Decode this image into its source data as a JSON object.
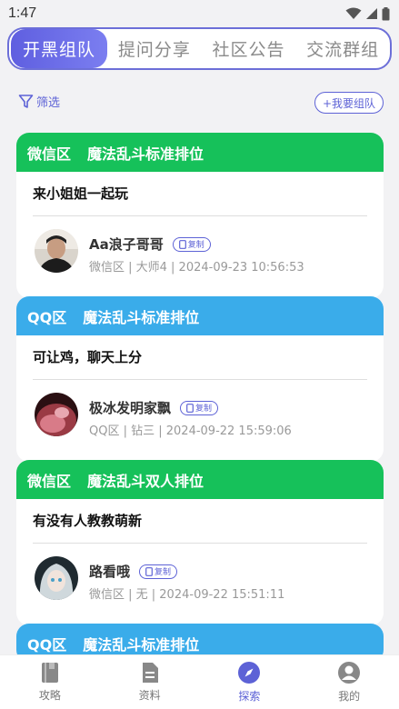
{
  "status": {
    "time": "1:47"
  },
  "tabs": [
    {
      "label": "开黑组队",
      "active": true
    },
    {
      "label": "提问分享",
      "active": false
    },
    {
      "label": "社区公告",
      "active": false
    },
    {
      "label": "交流群组",
      "active": false
    }
  ],
  "toolbar": {
    "filter_label": "筛选",
    "team_button": "+我要组队"
  },
  "copy_label": "复制",
  "posts": [
    {
      "region": "微信区",
      "mode": "魔法乱斗标准排位",
      "color": "#16c15a",
      "message": "来小姐姐一起玩",
      "username": "Aa浪子哥哥",
      "meta": "微信区 | 大师4 | 2024-09-23 10:56:53"
    },
    {
      "region": "QQ区",
      "mode": "魔法乱斗标准排位",
      "color": "#3aacea",
      "message": "可让鸡，聊天上分",
      "username": "极冰发明家飘",
      "meta": "QQ区 | 钻三 | 2024-09-22 15:59:06"
    },
    {
      "region": "微信区",
      "mode": "魔法乱斗双人排位",
      "color": "#16c15a",
      "message": "有没有人教教萌新",
      "username": "路看哦",
      "meta": "微信区 | 无 | 2024-09-22 15:51:11"
    },
    {
      "region": "QQ区",
      "mode": "魔法乱斗标准排位",
      "color": "#3aacea"
    }
  ],
  "nav": [
    {
      "label": "攻略",
      "icon": "book-icon",
      "active": false
    },
    {
      "label": "资料",
      "icon": "document-icon",
      "active": false
    },
    {
      "label": "探索",
      "icon": "compass-icon",
      "active": true
    },
    {
      "label": "我的",
      "icon": "user-icon",
      "active": false
    }
  ]
}
